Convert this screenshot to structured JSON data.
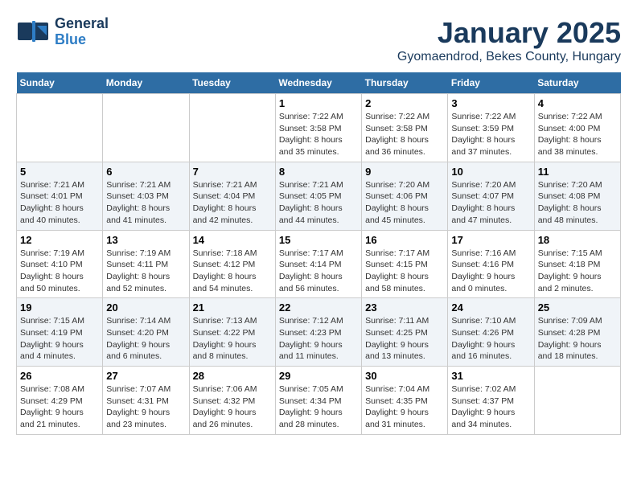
{
  "header": {
    "logo_general": "General",
    "logo_blue": "Blue",
    "month_title": "January 2025",
    "location": "Gyomaendrod, Bekes County, Hungary"
  },
  "days_of_week": [
    "Sunday",
    "Monday",
    "Tuesday",
    "Wednesday",
    "Thursday",
    "Friday",
    "Saturday"
  ],
  "weeks": [
    {
      "days": [
        {
          "number": "",
          "info": ""
        },
        {
          "number": "",
          "info": ""
        },
        {
          "number": "",
          "info": ""
        },
        {
          "number": "1",
          "info": "Sunrise: 7:22 AM\nSunset: 3:58 PM\nDaylight: 8 hours and 35 minutes."
        },
        {
          "number": "2",
          "info": "Sunrise: 7:22 AM\nSunset: 3:58 PM\nDaylight: 8 hours and 36 minutes."
        },
        {
          "number": "3",
          "info": "Sunrise: 7:22 AM\nSunset: 3:59 PM\nDaylight: 8 hours and 37 minutes."
        },
        {
          "number": "4",
          "info": "Sunrise: 7:22 AM\nSunset: 4:00 PM\nDaylight: 8 hours and 38 minutes."
        }
      ]
    },
    {
      "days": [
        {
          "number": "5",
          "info": "Sunrise: 7:21 AM\nSunset: 4:01 PM\nDaylight: 8 hours and 40 minutes."
        },
        {
          "number": "6",
          "info": "Sunrise: 7:21 AM\nSunset: 4:03 PM\nDaylight: 8 hours and 41 minutes."
        },
        {
          "number": "7",
          "info": "Sunrise: 7:21 AM\nSunset: 4:04 PM\nDaylight: 8 hours and 42 minutes."
        },
        {
          "number": "8",
          "info": "Sunrise: 7:21 AM\nSunset: 4:05 PM\nDaylight: 8 hours and 44 minutes."
        },
        {
          "number": "9",
          "info": "Sunrise: 7:20 AM\nSunset: 4:06 PM\nDaylight: 8 hours and 45 minutes."
        },
        {
          "number": "10",
          "info": "Sunrise: 7:20 AM\nSunset: 4:07 PM\nDaylight: 8 hours and 47 minutes."
        },
        {
          "number": "11",
          "info": "Sunrise: 7:20 AM\nSunset: 4:08 PM\nDaylight: 8 hours and 48 minutes."
        }
      ]
    },
    {
      "days": [
        {
          "number": "12",
          "info": "Sunrise: 7:19 AM\nSunset: 4:10 PM\nDaylight: 8 hours and 50 minutes."
        },
        {
          "number": "13",
          "info": "Sunrise: 7:19 AM\nSunset: 4:11 PM\nDaylight: 8 hours and 52 minutes."
        },
        {
          "number": "14",
          "info": "Sunrise: 7:18 AM\nSunset: 4:12 PM\nDaylight: 8 hours and 54 minutes."
        },
        {
          "number": "15",
          "info": "Sunrise: 7:17 AM\nSunset: 4:14 PM\nDaylight: 8 hours and 56 minutes."
        },
        {
          "number": "16",
          "info": "Sunrise: 7:17 AM\nSunset: 4:15 PM\nDaylight: 8 hours and 58 minutes."
        },
        {
          "number": "17",
          "info": "Sunrise: 7:16 AM\nSunset: 4:16 PM\nDaylight: 9 hours and 0 minutes."
        },
        {
          "number": "18",
          "info": "Sunrise: 7:15 AM\nSunset: 4:18 PM\nDaylight: 9 hours and 2 minutes."
        }
      ]
    },
    {
      "days": [
        {
          "number": "19",
          "info": "Sunrise: 7:15 AM\nSunset: 4:19 PM\nDaylight: 9 hours and 4 minutes."
        },
        {
          "number": "20",
          "info": "Sunrise: 7:14 AM\nSunset: 4:20 PM\nDaylight: 9 hours and 6 minutes."
        },
        {
          "number": "21",
          "info": "Sunrise: 7:13 AM\nSunset: 4:22 PM\nDaylight: 9 hours and 8 minutes."
        },
        {
          "number": "22",
          "info": "Sunrise: 7:12 AM\nSunset: 4:23 PM\nDaylight: 9 hours and 11 minutes."
        },
        {
          "number": "23",
          "info": "Sunrise: 7:11 AM\nSunset: 4:25 PM\nDaylight: 9 hours and 13 minutes."
        },
        {
          "number": "24",
          "info": "Sunrise: 7:10 AM\nSunset: 4:26 PM\nDaylight: 9 hours and 16 minutes."
        },
        {
          "number": "25",
          "info": "Sunrise: 7:09 AM\nSunset: 4:28 PM\nDaylight: 9 hours and 18 minutes."
        }
      ]
    },
    {
      "days": [
        {
          "number": "26",
          "info": "Sunrise: 7:08 AM\nSunset: 4:29 PM\nDaylight: 9 hours and 21 minutes."
        },
        {
          "number": "27",
          "info": "Sunrise: 7:07 AM\nSunset: 4:31 PM\nDaylight: 9 hours and 23 minutes."
        },
        {
          "number": "28",
          "info": "Sunrise: 7:06 AM\nSunset: 4:32 PM\nDaylight: 9 hours and 26 minutes."
        },
        {
          "number": "29",
          "info": "Sunrise: 7:05 AM\nSunset: 4:34 PM\nDaylight: 9 hours and 28 minutes."
        },
        {
          "number": "30",
          "info": "Sunrise: 7:04 AM\nSunset: 4:35 PM\nDaylight: 9 hours and 31 minutes."
        },
        {
          "number": "31",
          "info": "Sunrise: 7:02 AM\nSunset: 4:37 PM\nDaylight: 9 hours and 34 minutes."
        },
        {
          "number": "",
          "info": ""
        }
      ]
    }
  ]
}
